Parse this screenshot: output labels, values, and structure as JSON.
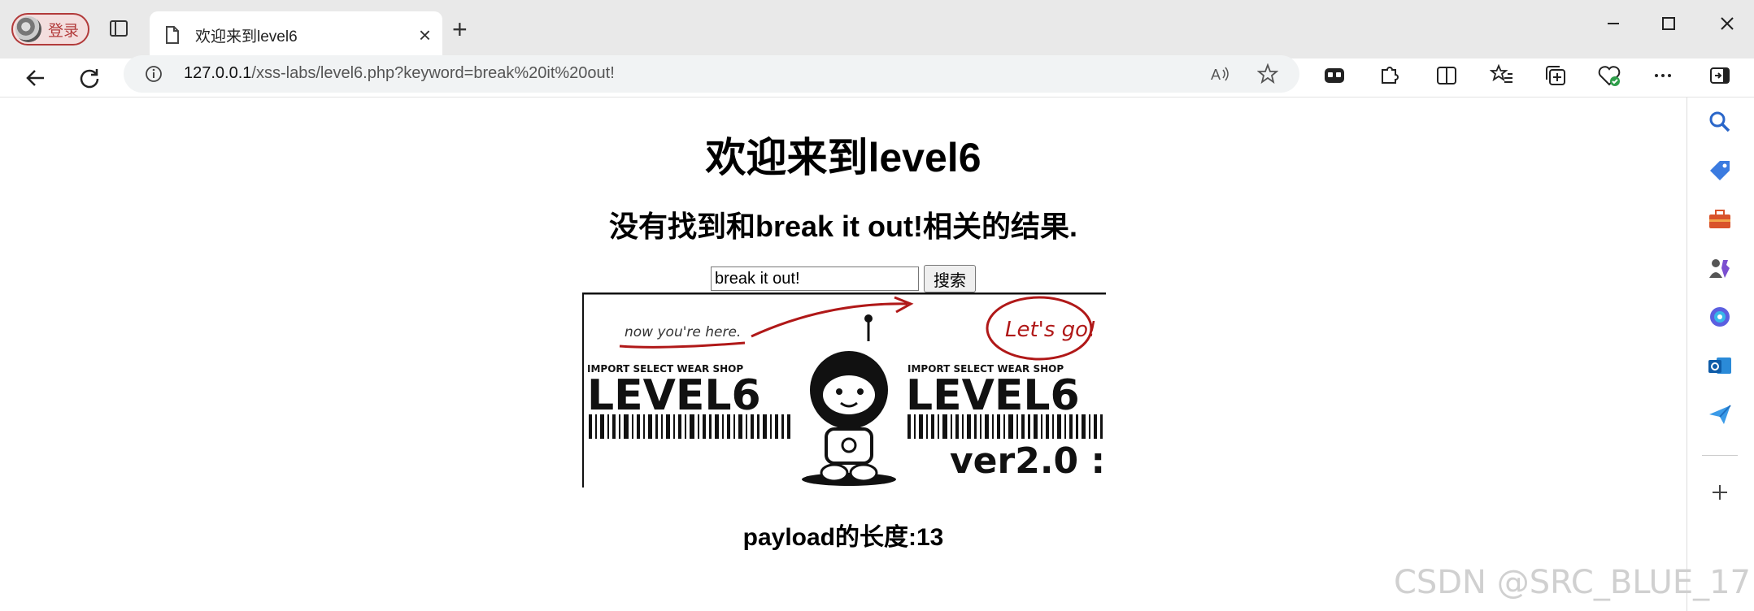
{
  "browser": {
    "profile_label": "登录",
    "tab_title": "欢迎来到level6",
    "url_host": "127.0.0.1",
    "url_path": "/xss-labs/level6.php?keyword=break%20it%20out!",
    "accent_color": "#b23a3a"
  },
  "page": {
    "title": "欢迎来到level6",
    "result_text": "没有找到和break it out!相关的结果.",
    "search_value": "break it out!",
    "search_button": "搜索",
    "payload_text": "payload的长度:13"
  },
  "banner": {
    "now_text": "now you're here.",
    "lets_go": "Let's go!",
    "shop_text": "IMPORT SELECT WEAR SHOP",
    "level_text": "LEVEL6",
    "version_text": "ver2.0 :"
  },
  "watermark": "CSDN @SRC_BLUE_17"
}
